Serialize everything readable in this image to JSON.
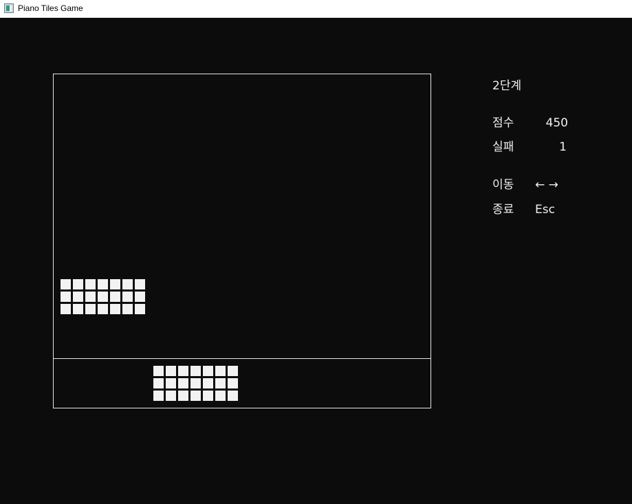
{
  "window": {
    "title": "Piano Tiles Game",
    "icon": "app-window-icon"
  },
  "colors": {
    "background": "#0c0c0c",
    "frame": "#e8e8e8",
    "tile": "#f2f2f2",
    "text": "#f0f0f0"
  },
  "board": {
    "falling_block": {
      "rows": 3,
      "cols": 7
    },
    "player_block": {
      "rows": 3,
      "cols": 7
    }
  },
  "hud": {
    "level": "2단계",
    "score_label": "점수",
    "score_value": "450",
    "miss_label": "실패",
    "miss_value": "1",
    "move_label": "이동",
    "move_keys": "← →",
    "quit_label": "종료",
    "quit_key": "Esc"
  }
}
